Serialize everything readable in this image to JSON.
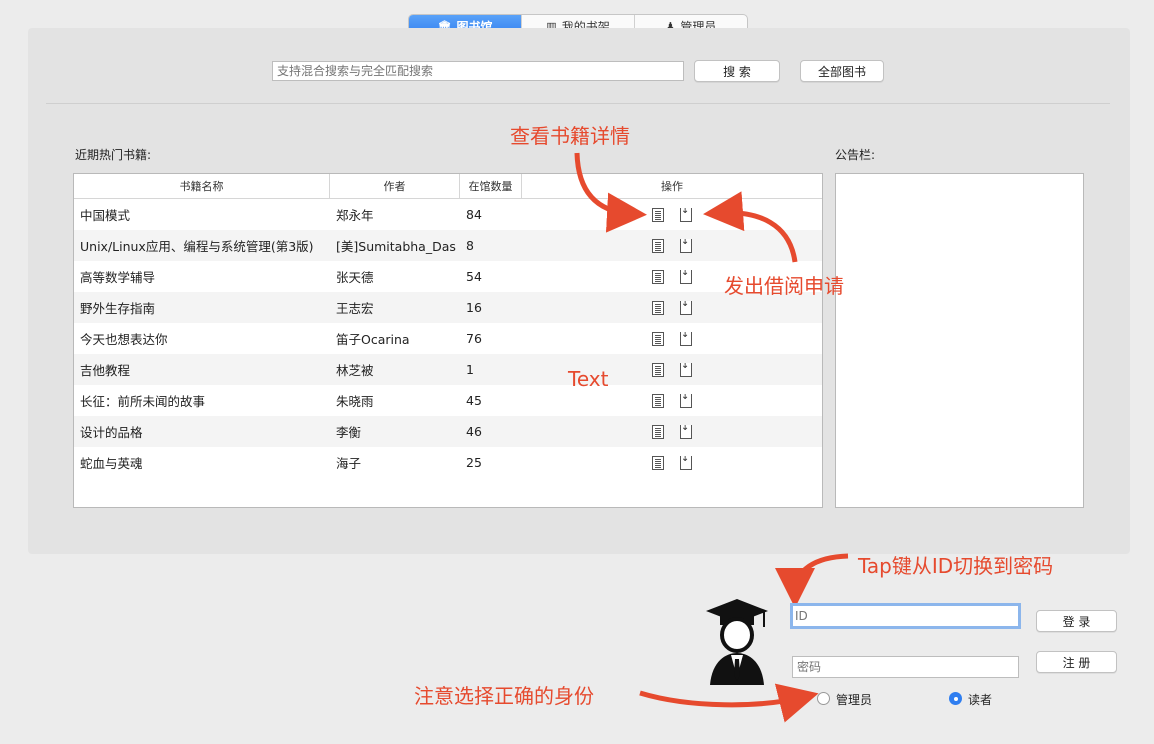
{
  "tabs": [
    {
      "label": "图书馆",
      "icon": "library-icon",
      "active": true
    },
    {
      "label": "我的书架",
      "icon": "bar-chart-icon",
      "active": false
    },
    {
      "label": "管理员",
      "icon": "admin-icon",
      "active": false
    }
  ],
  "search": {
    "placeholder": "支持混合搜索与完全匹配搜索",
    "search_label": "搜 索",
    "all_label": "全部图书"
  },
  "hot_books_label": "近期热门书籍:",
  "notice_label": "公告栏:",
  "table": {
    "columns": [
      "书籍名称",
      "作者",
      "在馆数量",
      "操作"
    ],
    "rows": [
      {
        "name": "中国模式",
        "author": "郑永年",
        "count": "84"
      },
      {
        "name": "Unix/Linux应用、编程与系统管理(第3版)",
        "author": "[美]Sumitabha_Das",
        "count": "8"
      },
      {
        "name": "高等数学辅导",
        "author": "张天德",
        "count": "54"
      },
      {
        "name": "野外生存指南",
        "author": "王志宏",
        "count": "16"
      },
      {
        "name": "今天也想表达你",
        "author": "笛子Ocarina",
        "count": "76"
      },
      {
        "name": "吉他教程",
        "author": "林芝被",
        "count": "1"
      },
      {
        "name": "长征：前所未闻的故事",
        "author": "朱晓雨",
        "count": "45"
      },
      {
        "name": "设计的品格",
        "author": "李衡",
        "count": "46"
      },
      {
        "name": "蛇血与英魂",
        "author": "海子",
        "count": "25"
      }
    ]
  },
  "annotations": {
    "view_details": "查看书籍详情",
    "borrow": "发出借阅申请",
    "text": "Text",
    "tab_hint": "Tap键从ID切换到密码",
    "role_hint": "注意选择正确的身份"
  },
  "login": {
    "id_placeholder": "ID",
    "password_placeholder": "密码",
    "login_label": "登 录",
    "register_label": "注 册",
    "role_admin": "管理员",
    "role_reader": "读者",
    "selected_role": "读者"
  },
  "colors": {
    "accent": "#2f7ef0",
    "annotation": "#e64a2e"
  }
}
